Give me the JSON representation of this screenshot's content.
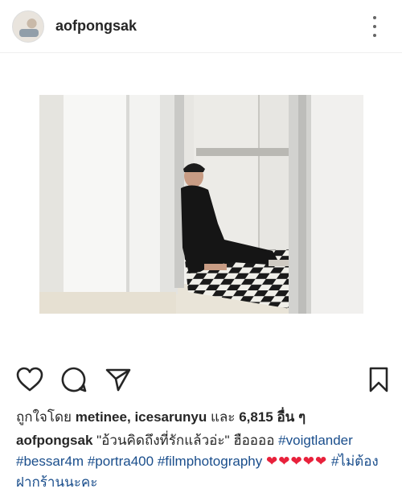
{
  "post": {
    "username": "aofpongsak"
  },
  "likes": {
    "prefix": "ถูกใจโดย",
    "user1": "metinee",
    "user2": "icesarunyu",
    "connector": "และ",
    "count": "6,815",
    "suffix": "อื่น ๆ"
  },
  "caption": {
    "username": "aofpongsak",
    "text": "\"อ้วนคิดถึงที่รักแล้วอ่ะ\" ฮืออออ",
    "tag1": "#voigtlander",
    "tag2": "#bessar4m",
    "tag3": "#portra400",
    "tag4": "#filmphotography",
    "hearts": "❤❤❤❤❤",
    "tag5": "#ไม่ต้องฝากร้านนะคะ"
  },
  "icons": {
    "like": "heart-icon",
    "comment": "comment-icon",
    "share": "send-icon",
    "save": "bookmark-icon",
    "more": "more-options-icon"
  }
}
